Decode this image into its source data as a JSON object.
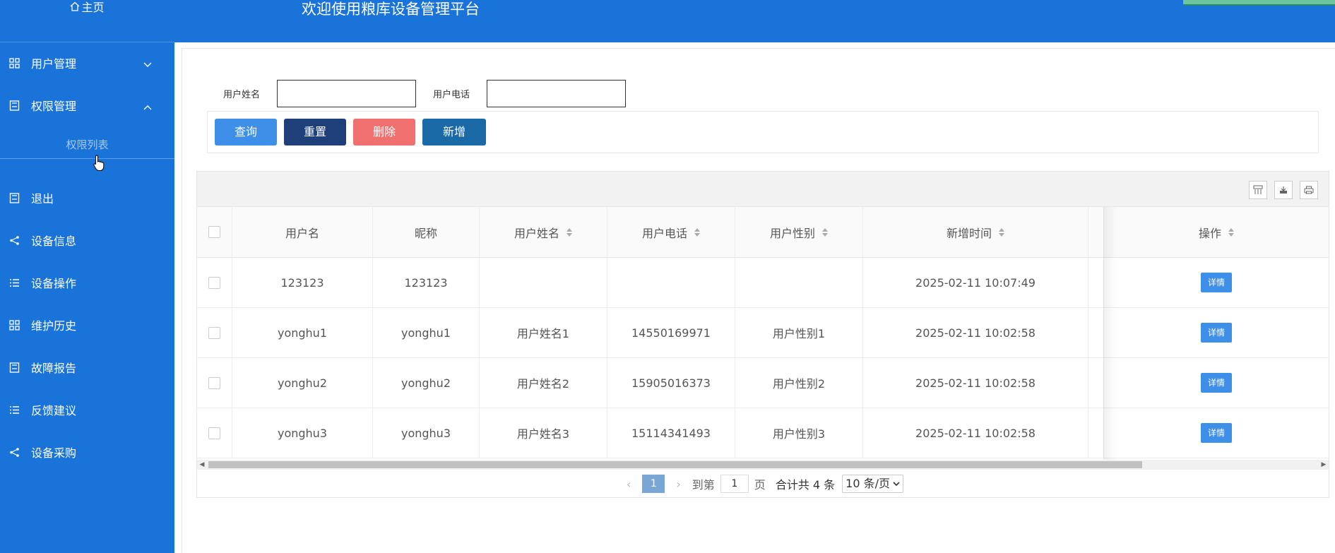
{
  "sidebar": {
    "home_label": "主页",
    "items": [
      {
        "label": "用户管理"
      },
      {
        "label": "权限管理"
      },
      {
        "label": "退出"
      },
      {
        "label": "设备信息"
      },
      {
        "label": "设备操作"
      },
      {
        "label": "维护历史"
      },
      {
        "label": "故障报告"
      },
      {
        "label": "反馈建议"
      },
      {
        "label": "设备采购"
      }
    ],
    "sub_item": "权限列表"
  },
  "header": {
    "title": "欢迎使用粮库设备管理平台"
  },
  "search": {
    "name_label": "用户姓名",
    "name_value": "",
    "phone_label": "用户电话",
    "phone_value": ""
  },
  "buttons": {
    "query": "查询",
    "reset": "重置",
    "delete": "删除",
    "add": "新增"
  },
  "table": {
    "columns": [
      "用户名",
      "昵称",
      "用户姓名",
      "用户电话",
      "用户性别",
      "新增时间",
      "操作"
    ],
    "rows": [
      {
        "username": "123123",
        "nickname": "123123",
        "realname": "",
        "phone": "",
        "gender": "",
        "created": "2025-02-11 10:07:49",
        "action": "详情"
      },
      {
        "username": "yonghu1",
        "nickname": "yonghu1",
        "realname": "用户姓名1",
        "phone": "14550169971",
        "gender": "用户性别1",
        "created": "2025-02-11 10:02:58",
        "action": "详情"
      },
      {
        "username": "yonghu2",
        "nickname": "yonghu2",
        "realname": "用户姓名2",
        "phone": "15905016373",
        "gender": "用户性别2",
        "created": "2025-02-11 10:02:58",
        "action": "详情"
      },
      {
        "username": "yonghu3",
        "nickname": "yonghu3",
        "realname": "用户姓名3",
        "phone": "15114341493",
        "gender": "用户性别3",
        "created": "2025-02-11 10:02:58",
        "action": "详情"
      }
    ]
  },
  "pager": {
    "current": "1",
    "goto_prefix": "到第",
    "goto_value": "1",
    "goto_suffix": "页",
    "total": "合计共 4 条",
    "page_size": "10 条/页"
  },
  "colors": {
    "sidebar_bg": "#1a73d9",
    "query_btn": "#3d8fe8",
    "reset_btn": "#1e3f7a",
    "delete_btn": "#f07070",
    "add_btn": "#1a6aa8"
  }
}
